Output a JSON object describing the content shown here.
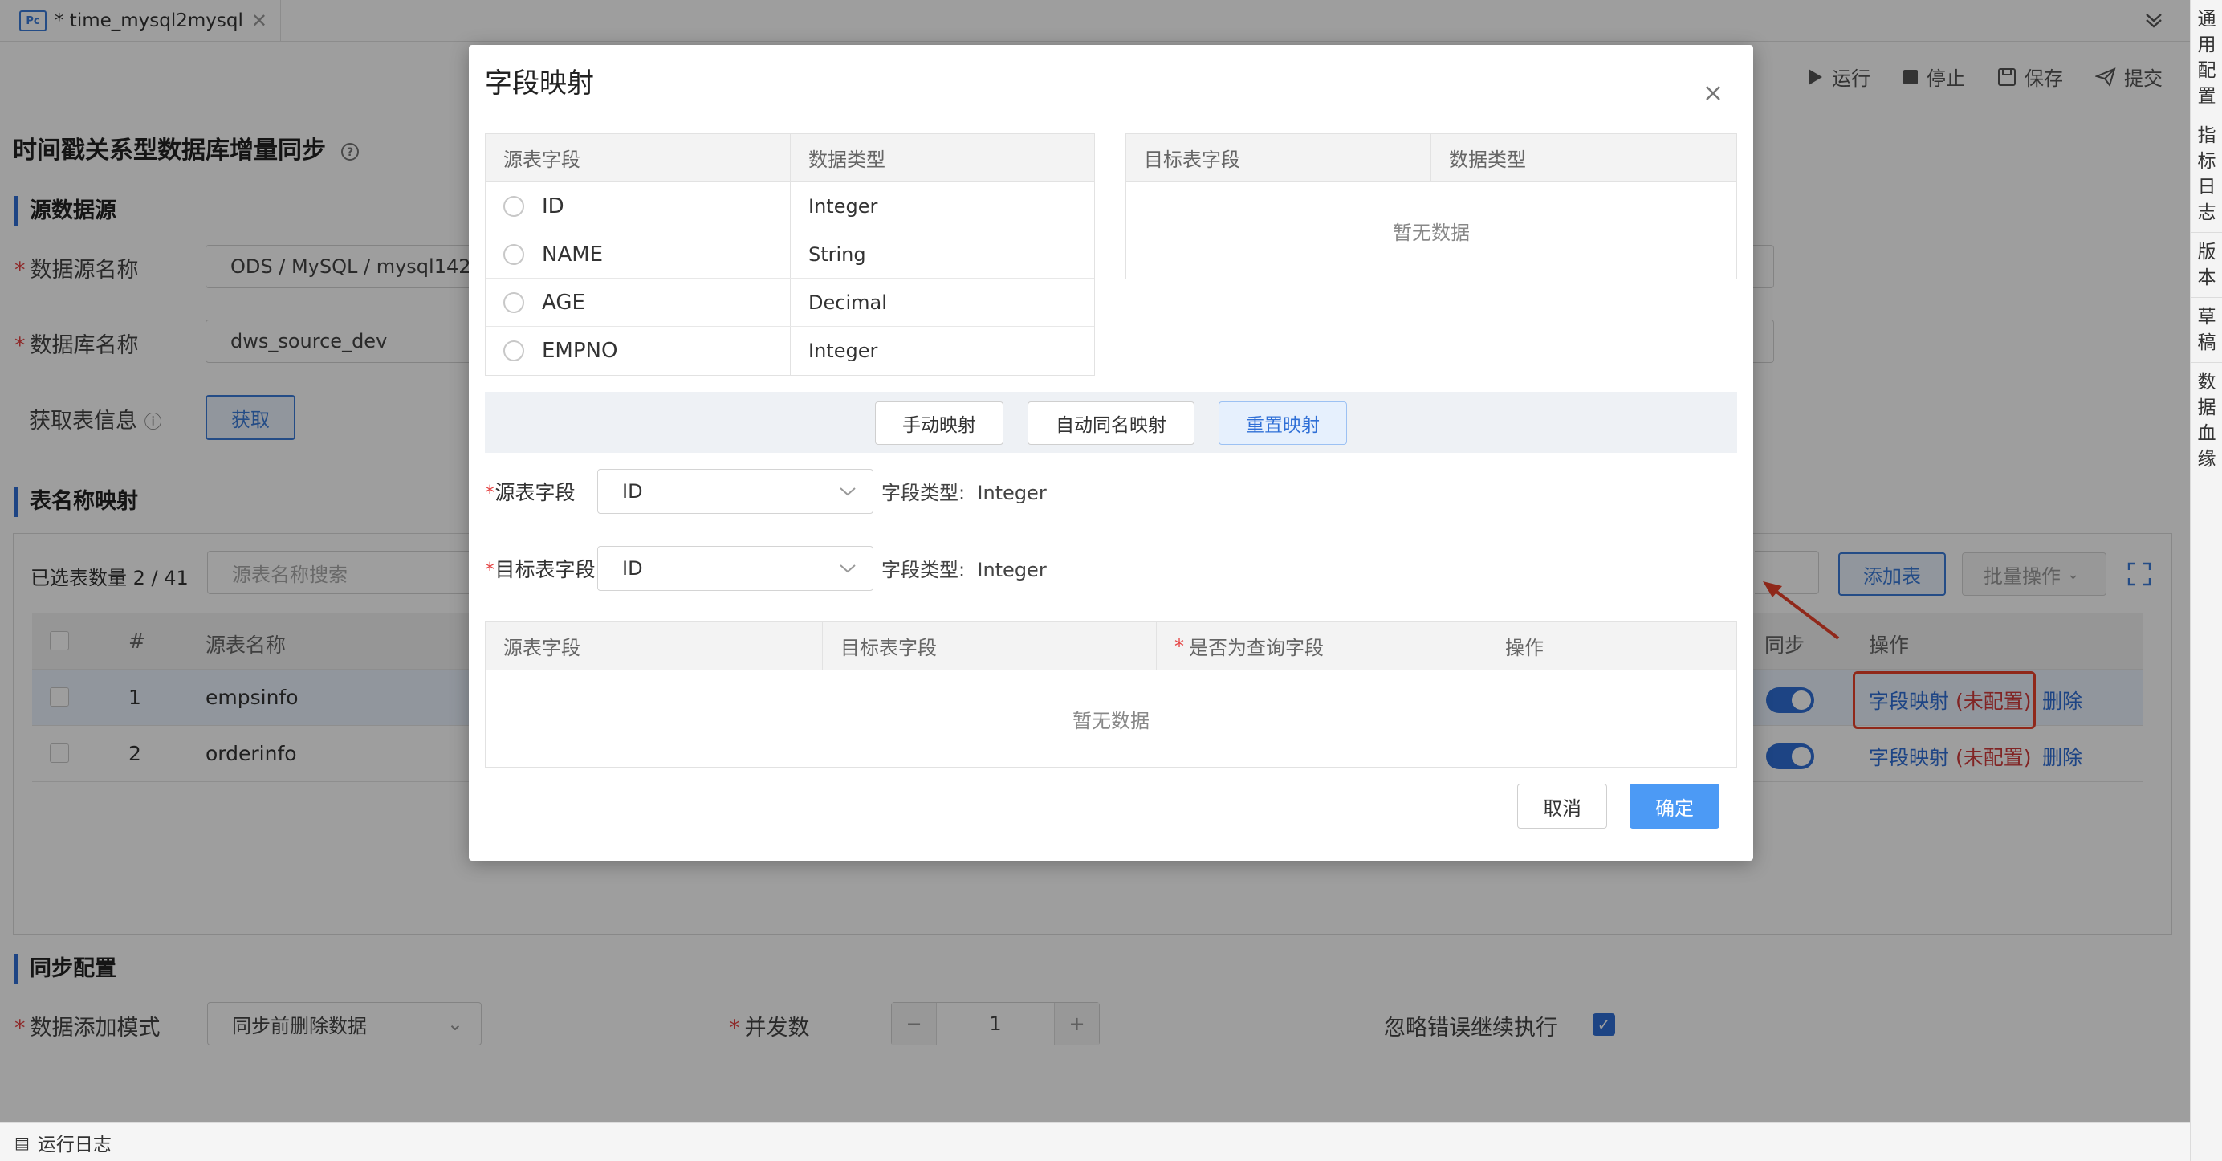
{
  "tab": {
    "badge": "Pc",
    "title": "* time_mysql2mysql"
  },
  "toolbar": {
    "run": "运行",
    "stop": "停止",
    "save": "保存",
    "submit": "提交"
  },
  "right_sidebar": [
    "通用配置",
    "指标日志",
    "版本",
    "草稿",
    "数据血缘"
  ],
  "page_title": "时间戳关系型数据库增量同步",
  "source_section": {
    "title": "源数据源",
    "datasource_label": "数据源名称",
    "datasource_value": "ODS / MySQL / mysql142",
    "database_label": "数据库名称",
    "database_value": "dws_source_dev",
    "fetch_label": "获取表信息",
    "fetch_button": "获取"
  },
  "mapping_section": {
    "title": "表名称映射",
    "selected_count": "已选表数量 2 / 41",
    "search_placeholder": "源表名称搜索",
    "add_table": "添加表",
    "batch_ops": "批量操作",
    "columns": {
      "index": "#",
      "source_name": "源表名称",
      "sync": "同步",
      "ops": "操作"
    },
    "rows": [
      {
        "index": "1",
        "name": "empsinfo",
        "field_map": "字段映射 (未配置)",
        "delete": "删除"
      },
      {
        "index": "2",
        "name": "orderinfo",
        "field_map": "字段映射 (未配置)",
        "delete": "删除"
      }
    ]
  },
  "sync_section": {
    "title": "同步配置",
    "mode_label": "数据添加模式",
    "mode_value": "同步前删除数据",
    "concurrency_label": "并发数",
    "concurrency_value": "1",
    "ignore_label": "忽略错误继续执行"
  },
  "statusbar": {
    "label": "运行日志"
  },
  "modal": {
    "title": "字段映射",
    "source_table": {
      "headers": [
        "源表字段",
        "数据类型"
      ],
      "rows": [
        {
          "field": "ID",
          "type": "Integer"
        },
        {
          "field": "NAME",
          "type": "String"
        },
        {
          "field": "AGE",
          "type": "Decimal"
        },
        {
          "field": "EMPNO",
          "type": "Integer"
        }
      ]
    },
    "target_table": {
      "headers": [
        "目标表字段",
        "数据类型"
      ],
      "empty": "暂无数据"
    },
    "buttons": {
      "manual": "手动映射",
      "auto": "自动同名映射",
      "reset": "重置映射"
    },
    "source_field_label": "源表字段",
    "source_field_value": "ID",
    "source_type_label": "字段类型:",
    "source_type_value": "Integer",
    "target_field_label": "目标表字段",
    "target_field_value": "ID",
    "target_type_label": "字段类型:",
    "target_type_value": "Integer",
    "result_table": {
      "headers": [
        "源表字段",
        "目标表字段",
        "是否为查询字段",
        "操作"
      ],
      "empty": "暂无数据"
    },
    "cancel": "取消",
    "confirm": "确定"
  },
  "colors": {
    "accent": "#2f6fd6",
    "primary_button": "#4c9af5",
    "danger": "#d03a3a",
    "highlight_box": "#e8412a"
  }
}
